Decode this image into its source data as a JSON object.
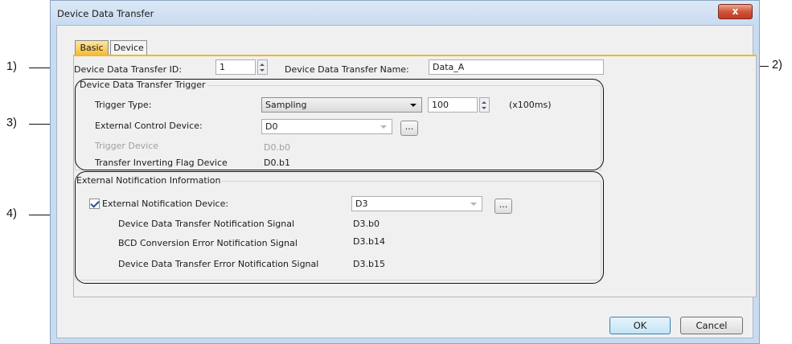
{
  "window": {
    "title": "Device Data Transfer",
    "close_glyph": "x"
  },
  "tabs": [
    {
      "label": "Basic",
      "active": true
    },
    {
      "label": "Device",
      "active": false
    }
  ],
  "fields": {
    "id_label": "Device Data Transfer ID:",
    "id_value": "1",
    "name_label": "Device Data Transfer Name:",
    "name_value": "Data_A"
  },
  "trigger_group": {
    "title": "Device Data Transfer Trigger",
    "trigger_type_label": "Trigger Type:",
    "trigger_type_value": "Sampling",
    "interval_value": "100",
    "interval_unit": "(x100ms)",
    "ext_control_label": "External Control Device:",
    "ext_control_value": "D0",
    "trigger_device_label": "Trigger Device",
    "trigger_device_value": "D0.b0",
    "inverting_label": "Transfer Inverting Flag Device",
    "inverting_value": "D0.b1"
  },
  "notification_group": {
    "title": "External Notification Information",
    "ext_notif_label": "External Notification Device:",
    "ext_notif_checked": true,
    "ext_notif_value": "D3",
    "rows": [
      {
        "label": "Device Data Transfer Notification Signal",
        "value": "D3.b0"
      },
      {
        "label": "BCD Conversion Error Notification Signal",
        "value": "D3.b14"
      },
      {
        "label": "Device Data Transfer Error Notification Signal",
        "value": "D3.b15"
      }
    ]
  },
  "buttons": {
    "ok": "OK",
    "cancel": "Cancel",
    "ellipsis": "..."
  },
  "callouts": {
    "c1": "1)",
    "c2": "2)",
    "c3": "3)",
    "c4": "4)"
  },
  "colors": {
    "tab_active": "#f6bd39",
    "window_frame": "#c9dbf0",
    "close_button": "#c23a22"
  }
}
